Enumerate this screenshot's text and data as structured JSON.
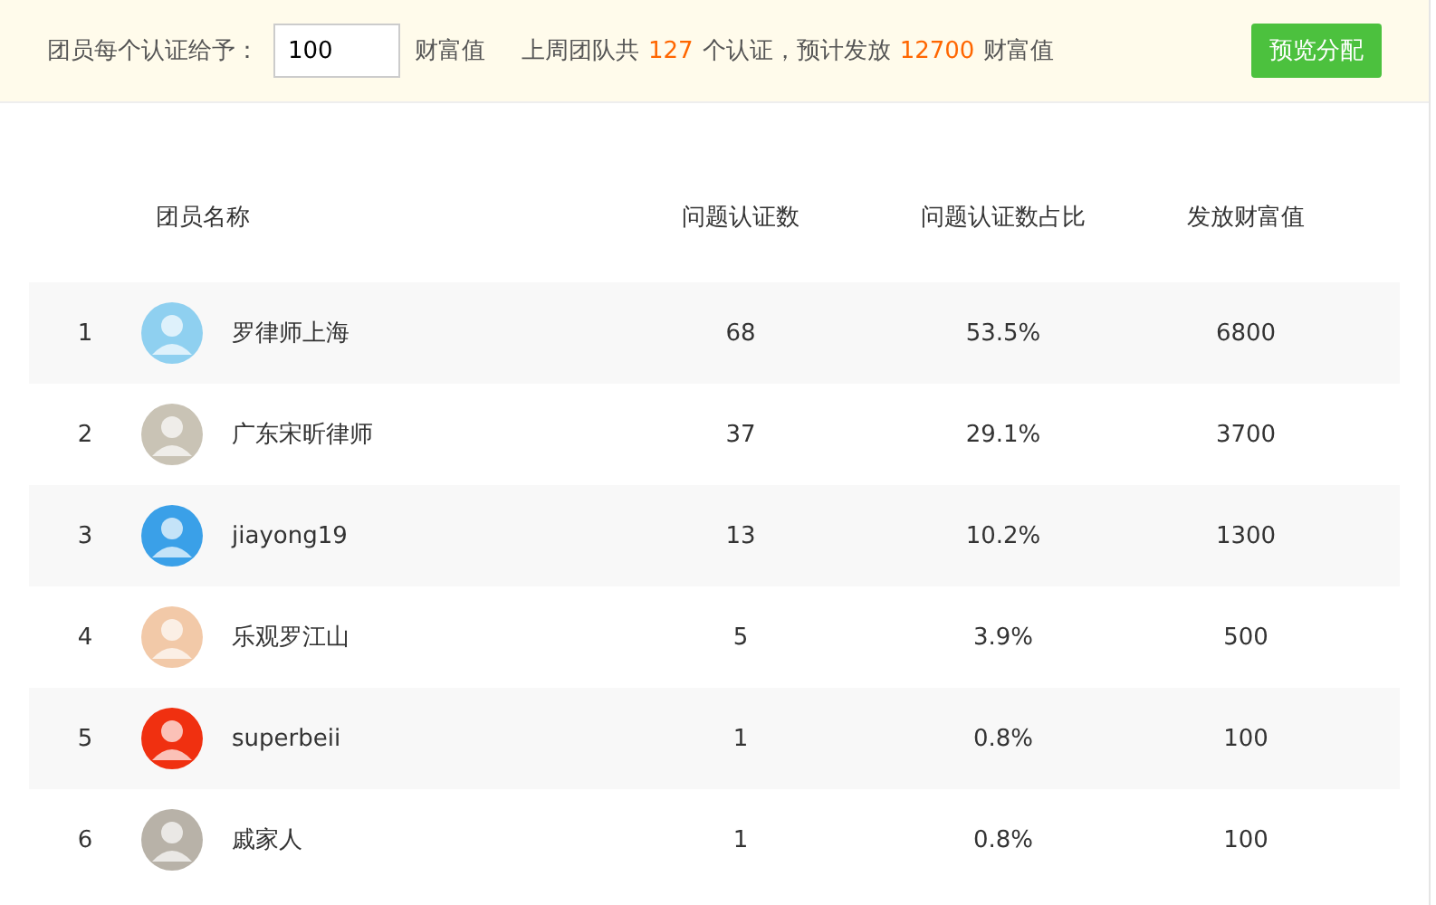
{
  "toolbar": {
    "label": "团员每个认证给予：",
    "input_value": "100",
    "unit": "财富值",
    "summary": {
      "prefix": "上周团队共",
      "count": "127",
      "middle": "个认证，预计发放",
      "total": "12700",
      "suffix": "财富值"
    },
    "button": "预览分配"
  },
  "table": {
    "columns": [
      "团员名称",
      "问题认证数",
      "问题认证数占比",
      "发放财富值"
    ],
    "rows": [
      {
        "rank": "1",
        "name": "罗律师上海",
        "count": "68",
        "share": "53.5%",
        "wealth": "6800",
        "color": "#8fd0f0"
      },
      {
        "rank": "2",
        "name": "广东宋昕律师",
        "count": "37",
        "share": "29.1%",
        "wealth": "3700",
        "color": "#c9c3b5"
      },
      {
        "rank": "3",
        "name": "jiayong19",
        "count": "13",
        "share": "10.2%",
        "wealth": "1300",
        "color": "#3aa0e8"
      },
      {
        "rank": "4",
        "name": "乐观罗江山",
        "count": "5",
        "share": "3.9%",
        "wealth": "500",
        "color": "#f2c9a8"
      },
      {
        "rank": "5",
        "name": "superbeii",
        "count": "1",
        "share": "0.8%",
        "wealth": "100",
        "color": "#f03010"
      },
      {
        "rank": "6",
        "name": "戚家人",
        "count": "1",
        "share": "0.8%",
        "wealth": "100",
        "color": "#b8b2a8"
      }
    ]
  }
}
